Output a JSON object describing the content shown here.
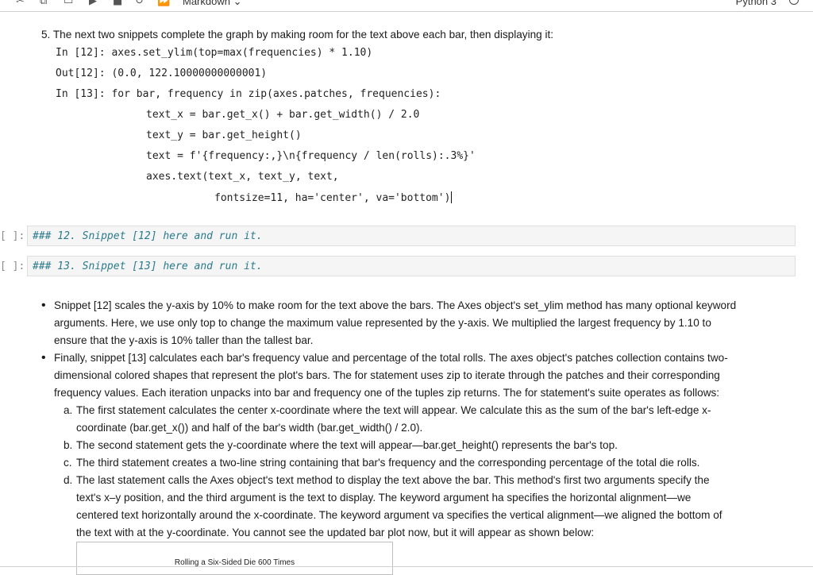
{
  "toolbar": {
    "cell_type": "Markdown",
    "kernel": "Python 3",
    "icons": [
      "scissors-icon",
      "copy-icon",
      "paste-icon",
      "run-icon",
      "stop-icon",
      "restart-icon",
      "fast-forward-icon",
      "chevron-down-icon",
      "kernel-status-icon"
    ]
  },
  "step5": {
    "text": "5. The next two snippets complete the graph by making room for the text above each bar, then displaying it:"
  },
  "code": {
    "in12_prompt": "In [12]:",
    "in12_code": "axes.set_ylim(top=max(frequencies) * 1.10)",
    "out12_prompt": "Out[12]:",
    "out12_value": "(0.0, 122.10000000000001)",
    "in13_prompt": "In [13]:",
    "in13_line1": "for bar, frequency in zip(axes.patches, frequencies):",
    "in13_line2": "text_x = bar.get_x() + bar.get_width() / 2.0",
    "in13_line3": "text_y = bar.get_height()",
    "in13_line4": "text = f'{frequency:,}\\n{frequency / len(rolls):.3%}'",
    "in13_line5": "axes.text(text_x, text_y, text,",
    "in13_line6": "fontsize=11, ha='center', va='bottom')"
  },
  "cells": [
    {
      "prompt": "[ ]:",
      "text": "### 12. Snippet [12] here and run it."
    },
    {
      "prompt": "[ ]:",
      "text": "### 13. Snippet [13] here and run it."
    }
  ],
  "bullets": {
    "b1_l1": "Snippet [12] scales the y-axis by 10% to make room for the text above the bars. The Axes object's set_ylim method has many optional keyword",
    "b1_l2": "arguments. Here, we use only top to change the maximum value represented by the y-axis. We multiplied the largest frequency by 1.10 to",
    "b1_l3": "ensure that the y-axis is 10% taller than the tallest bar.",
    "b2_l1": "Finally, snippet [13] calculates each bar's frequency value and percentage of the total rolls. The axes object's patches collection contains two-",
    "b2_l2": "dimensional colored shapes that represent the plot's bars. The for statement uses zip to iterate through the patches and their corresponding",
    "b2_l3": "frequency values. Each iteration unpacks into bar and frequency one of the tuples zip returns. The for statement's suite operates as follows:"
  },
  "steps": {
    "a_label": "a.",
    "a_l1": "The first statement calculates the center x-coordinate where the text will appear. We calculate this as the sum of the bar's left-edge x-",
    "a_l2": "coordinate (bar.get_x()) and half of the bar's width (bar.get_width() / 2.0).",
    "b_label": "b.",
    "b_l1": "The second statement gets the y-coordinate where the text will appear—bar.get_height() represents the bar's top.",
    "c_label": "c.",
    "c_l1": "The third statement creates a two-line string containing that bar's frequency and the corresponding percentage of the total die rolls.",
    "d_label": "d.",
    "d_l1": "The last statement calls the Axes object's text method to display the text above the bar. This method's first two arguments specify the",
    "d_l2": "text's x–y position, and the third argument is the text to display. The keyword argument ha specifies the horizontal alignment—we",
    "d_l3": "centered text horizontally around the x-coordinate. The keyword argument va specifies the vertical alignment—we aligned the bottom of",
    "d_l4": "the text with at the y-coordinate. You cannot see the updated bar plot now, but it will appear as shown below:"
  },
  "figure": {
    "title": "Rolling a Six-Sided Die 600 Times"
  }
}
